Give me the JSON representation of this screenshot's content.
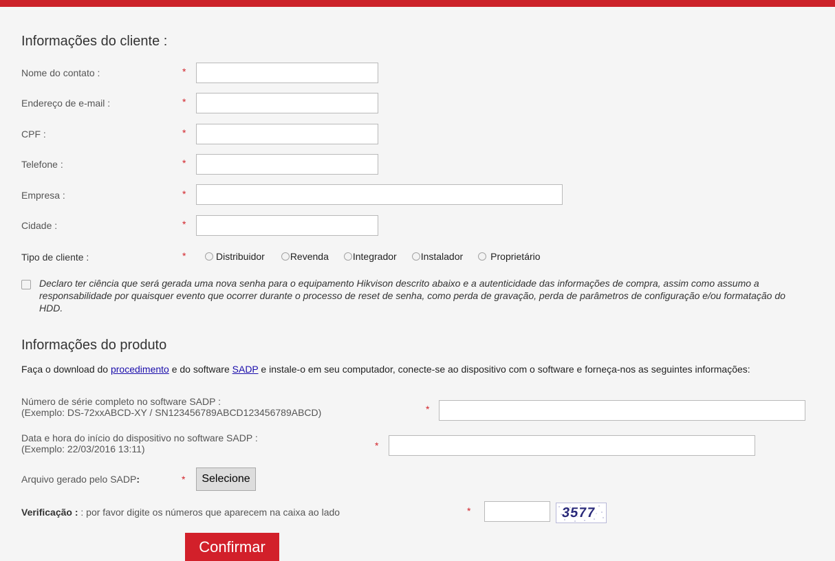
{
  "colors": {
    "accent": "#cc2229",
    "required": "#d2232a",
    "link": "#1a0dab",
    "confirm_button": "#d2202a"
  },
  "customer": {
    "section_title": "Informações do cliente :",
    "fields": {
      "contact_name": {
        "label": "Nome do contato :",
        "value": ""
      },
      "email": {
        "label": "Endereço de e-mail :",
        "value": ""
      },
      "cpf": {
        "label": "CPF :",
        "value": ""
      },
      "phone": {
        "label": "Telefone :",
        "value": ""
      },
      "company": {
        "label": "Empresa :",
        "value": ""
      },
      "city": {
        "label": "Cidade :",
        "value": ""
      }
    },
    "customer_type": {
      "label": "Tipo de cliente :",
      "options": [
        "Distribuidor",
        "Revenda",
        "Integrador",
        "Instalador",
        "Proprietário"
      ],
      "selected": null
    },
    "required_mark": "*"
  },
  "declaration": {
    "checked": false,
    "text": "Declaro ter ciência que será gerada uma nova senha para o equipamento Hikvison descrito abaixo e a autenticidade das informações de compra, assim como assumo a responsabilidade por quaisquer evento que ocorrer durante o processo de reset de senha, como perda de gravação, perda de parâmetros de configuração e/ou formatação do HDD."
  },
  "product": {
    "section_title": "Informações do produto",
    "intro": {
      "part1": "Faça o download do ",
      "link1": "procedimento",
      "part2": " e do software ",
      "link2": "SADP",
      "part3": " e instale-o em seu computador, conecte-se ao dispositivo com o software e forneça-nos as seguintes informações:"
    },
    "serial": {
      "label_line1": "Número de série completo no software SADP :",
      "label_line2": "(Exemplo: DS-72xxABCD-XY / SN123456789ABCD123456789ABCD)",
      "value": ""
    },
    "start_time": {
      "label_line1": "Data e hora do início do dispositivo no software SADP :",
      "label_line2": "(Exemplo: 22/03/2016 13:11)",
      "value": ""
    },
    "file": {
      "label": "Arquivo gerado pelo SADP",
      "colon": ":",
      "button": "Selecione"
    },
    "verification": {
      "label_bold": "Verificação :",
      "label_rest": ": por favor digite os números que aparecem na caixa ao lado",
      "value": "",
      "captcha": "3577"
    },
    "confirm_button": "Confirmar"
  }
}
